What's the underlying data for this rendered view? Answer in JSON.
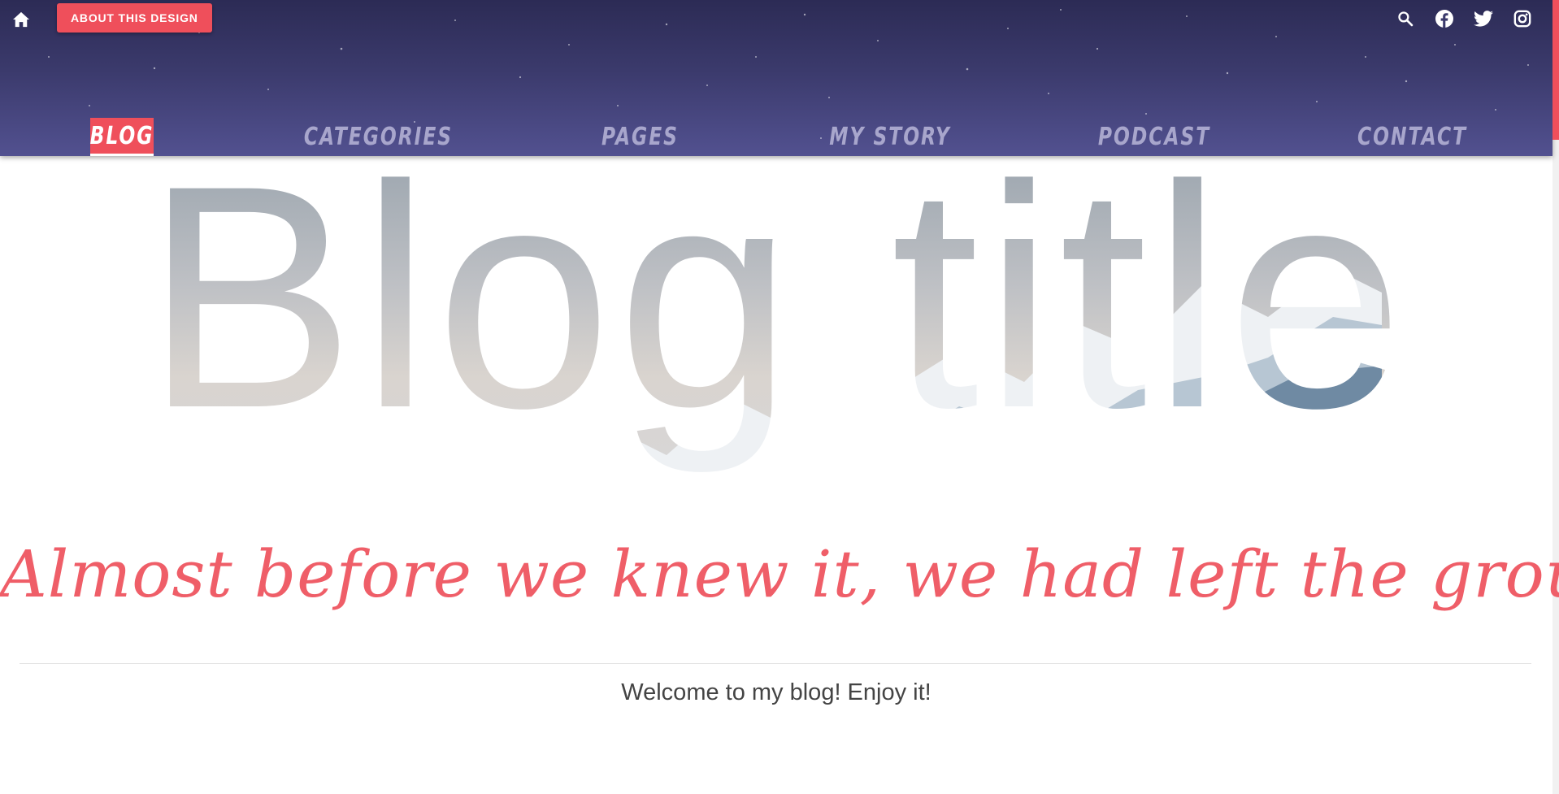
{
  "header": {
    "about_button": "ABOUT THIS DESIGN",
    "home_icon": "home-icon",
    "social_icons": [
      "search-icon",
      "facebook-icon",
      "twitter-icon",
      "instagram-icon"
    ]
  },
  "nav": {
    "items": [
      {
        "label": "BLOG",
        "active": true
      },
      {
        "label": "CATEGORIES",
        "active": false
      },
      {
        "label": "PAGES",
        "active": false
      },
      {
        "label": "MY STORY",
        "active": false
      },
      {
        "label": "PODCAST",
        "active": false
      },
      {
        "label": "CONTACT",
        "active": false
      }
    ]
  },
  "hero": {
    "title": "Blog title",
    "tagline": "Almost before we knew it, we had left the ground."
  },
  "content": {
    "welcome": "Welcome to my blog! Enjoy it!"
  },
  "colors": {
    "accent": "#ef4f5b",
    "header_top": "#2c2b55",
    "header_bottom": "#525190",
    "nav_text": "#a8a6cc",
    "tagline": "#ef5e68"
  }
}
